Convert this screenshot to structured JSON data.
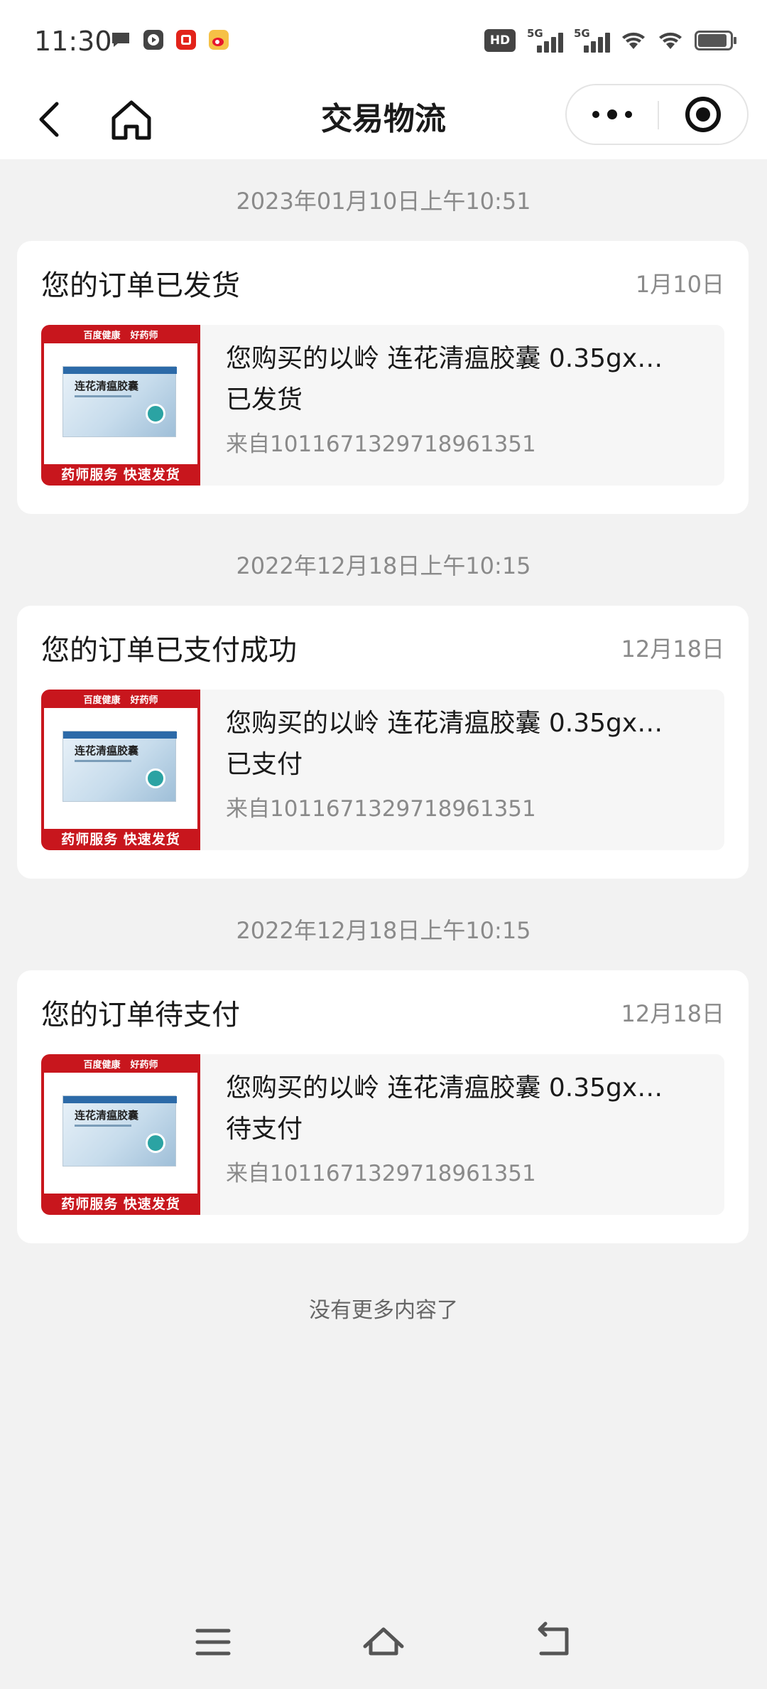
{
  "status_bar": {
    "time": "11:30",
    "hd_label": "HD",
    "signal_1_label": "5G",
    "signal_2_label": "5G",
    "app_icons": [
      "chat-bubble-icon",
      "video-play-icon",
      "red-app-icon",
      "weibo-icon"
    ],
    "battery_level": 0.85
  },
  "nav": {
    "title": "交易物流"
  },
  "messages": [
    {
      "timestamp": "2023年01月10日上午10:51",
      "title": "您的订单已发货",
      "date": "1月10日",
      "product_name": "您购买的以岭 连花清瘟胶囊 0.35gx…",
      "status": "已发货",
      "source": "来自1011671329718961351"
    },
    {
      "timestamp": "2022年12月18日上午10:15",
      "title": "您的订单已支付成功",
      "date": "12月18日",
      "product_name": "您购买的以岭 连花清瘟胶囊 0.35gx…",
      "status": "已支付",
      "source": "来自1011671329718961351"
    },
    {
      "timestamp": "2022年12月18日上午10:15",
      "title": "您的订单待支付",
      "date": "12月18日",
      "product_name": "您购买的以岭 连花清瘟胶囊 0.35gx…",
      "status": "待支付",
      "source": "来自1011671329718961351"
    }
  ],
  "thumbnail": {
    "top_left": "百度健康",
    "top_right": "好药师",
    "box_name": "连花清瘟胶囊",
    "bottom": "药师服务 快速发货"
  },
  "end_note": "没有更多内容了",
  "colors": {
    "page_bg": "#f2f2f2",
    "card_bg": "#ffffff",
    "product_bg": "#f6f6f6",
    "thumb_red": "#c8161d",
    "muted_text": "#8a8a8a"
  }
}
